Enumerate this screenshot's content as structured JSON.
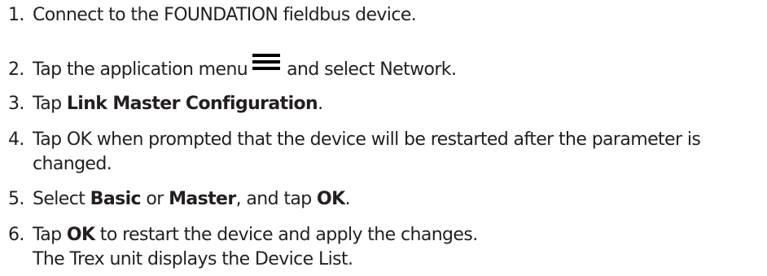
{
  "steps": [
    {
      "number": "1.",
      "text": "Connect to the FOUNDATION fieldbus device."
    },
    {
      "number": "2.",
      "before_icon": "Tap the application menu",
      "icon": "hamburger-menu-icon",
      "after_icon": "and select Network."
    },
    {
      "number": "3.",
      "pre": "Tap ",
      "bold": "Link Master Configuration",
      "post": "."
    },
    {
      "number": "4.",
      "line1": "Tap OK when prompted that the device will be restarted after the parameter is",
      "line2": "changed."
    },
    {
      "number": "5.",
      "pre": "Select ",
      "bold1": "Basic",
      "mid": " or ",
      "bold2": "Master",
      "mid2": ", and tap ",
      "bold3": "OK",
      "post": "."
    },
    {
      "number": "6.",
      "pre": "Tap ",
      "bold": "OK",
      "post": " to restart the device and apply the changes.",
      "line2": "The Trex unit displays the Device List."
    }
  ]
}
